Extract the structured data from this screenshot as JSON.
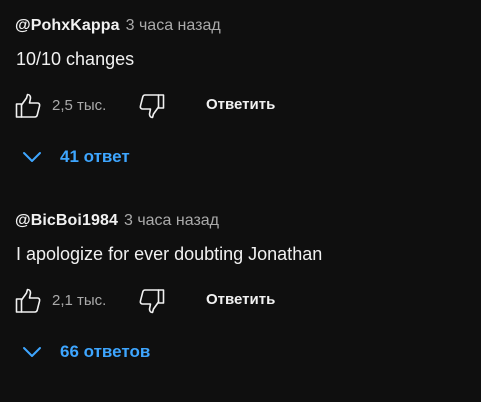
{
  "comments": [
    {
      "author": "@PohxKappa",
      "time": "3 часа назад",
      "text": "10/10 changes",
      "likes": "2,5 тыс.",
      "reply_label": "Ответить",
      "replies_label": "41 ответ"
    },
    {
      "author": "@BicBoi1984",
      "time": "3 часа назад",
      "text": "I apologize for ever doubting Jonathan",
      "likes": "2,1 тыс.",
      "reply_label": "Ответить",
      "replies_label": "66 ответов"
    }
  ],
  "icons": {
    "like": "thumbs-up-icon",
    "dislike": "thumbs-down-icon",
    "expand": "chevron-down-icon"
  },
  "colors": {
    "background": "#0f0f0f",
    "text": "#f1f1f1",
    "muted": "#aaaaaa",
    "link": "#3ea6ff"
  }
}
